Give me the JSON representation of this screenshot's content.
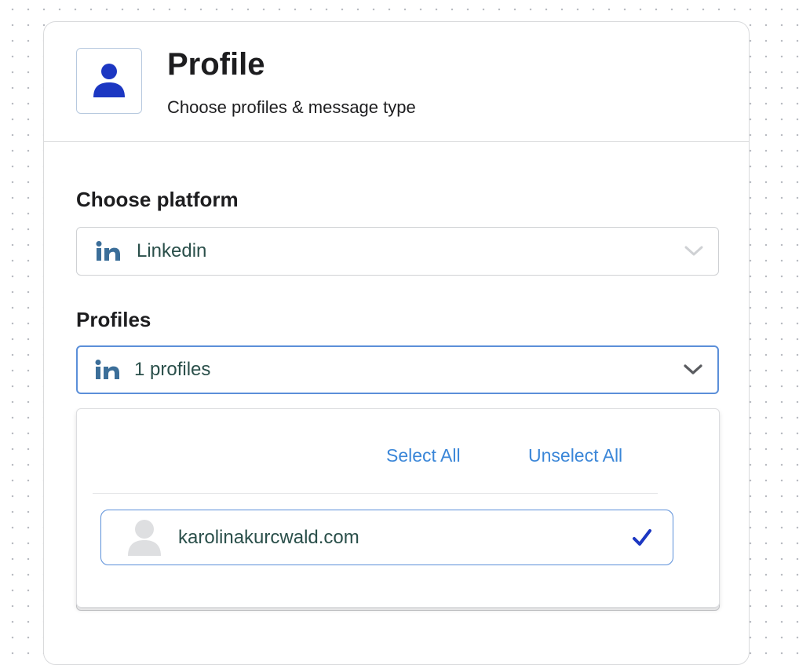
{
  "header": {
    "title": "Profile",
    "subtitle": "Choose profiles & message type",
    "icon": "user-icon"
  },
  "platform": {
    "label": "Choose platform",
    "selected": "Linkedin",
    "icon": "linkedin-icon"
  },
  "profiles": {
    "label": "Profiles",
    "selected": "1 profiles",
    "icon": "linkedin-icon",
    "dropdown": {
      "select_all": "Select All",
      "unselect_all": "Unselect All",
      "options": [
        {
          "name": "karolinakurcwald.com",
          "checked": true
        }
      ]
    }
  },
  "colors": {
    "accent": "#3a86d8",
    "icon_blue": "#1c37c2",
    "linkedin": "#3b6e99",
    "option_text": "#2a4f4a"
  }
}
